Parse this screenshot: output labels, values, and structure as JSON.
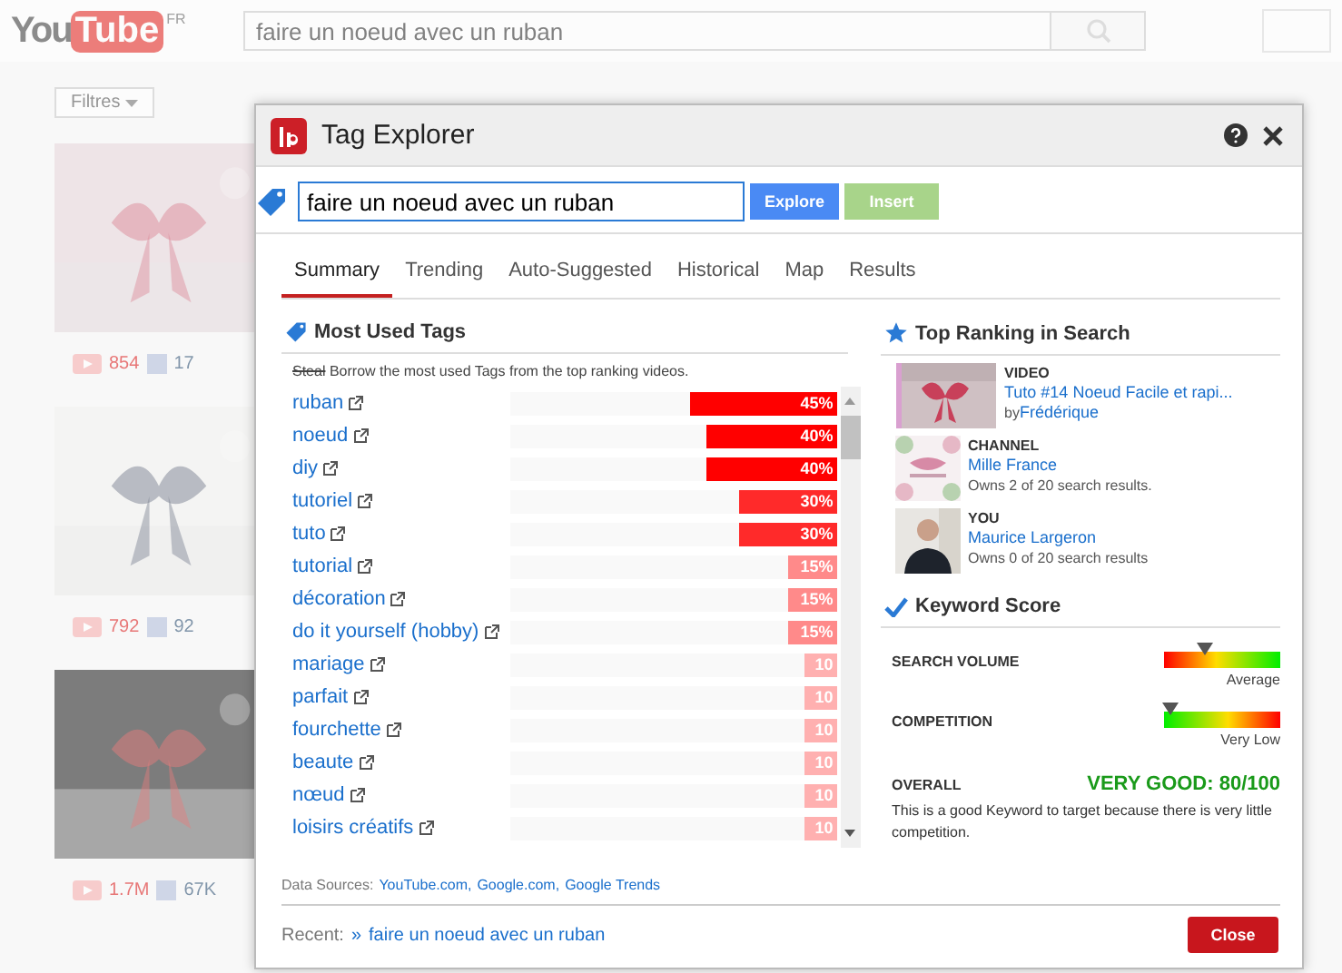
{
  "background": {
    "logo_you": "You",
    "logo_tube": "Tube",
    "logo_region": "FR",
    "search_value": "faire un noeud avec un ruban",
    "filter_button": "Filtres",
    "videos": [
      {
        "views": "854",
        "shares": "17"
      },
      {
        "views": "792",
        "shares": "92"
      },
      {
        "views": "1.7M",
        "shares": "67K"
      }
    ]
  },
  "dialog": {
    "title": "Tag Explorer",
    "search_value": "faire un noeud avec un ruban",
    "explore_button": "Explore",
    "insert_button": "Insert",
    "tabs": [
      {
        "label": "Summary",
        "selected": true
      },
      {
        "label": "Trending",
        "selected": false
      },
      {
        "label": "Auto-Suggested",
        "selected": false
      },
      {
        "label": "Historical",
        "selected": false
      },
      {
        "label": "Map",
        "selected": false
      },
      {
        "label": "Results",
        "selected": false
      }
    ],
    "most_used": {
      "title": "Most Used Tags",
      "struck": "Steal",
      "description": "Borrow the most used Tags from the top ranking videos.",
      "tags": [
        {
          "name": "ruban",
          "value": "45%",
          "level": 0.45,
          "color": "#ff0000"
        },
        {
          "name": "noeud",
          "value": "40%",
          "level": 0.4,
          "color": "#ff0000"
        },
        {
          "name": "diy",
          "value": "40%",
          "level": 0.4,
          "color": "#ff0000"
        },
        {
          "name": "tutoriel",
          "value": "30%",
          "level": 0.3,
          "color": "#ff2a2a"
        },
        {
          "name": "tuto",
          "value": "30%",
          "level": 0.3,
          "color": "#ff2a2a"
        },
        {
          "name": "tutorial",
          "value": "15%",
          "level": 0.15,
          "color": "#ff8a8a"
        },
        {
          "name": "décoration",
          "value": "15%",
          "level": 0.15,
          "color": "#ff8a8a"
        },
        {
          "name": "do it yourself (hobby)",
          "value": "15%",
          "level": 0.15,
          "color": "#ff8a8a"
        },
        {
          "name": "mariage",
          "value": "10",
          "level": 0.1,
          "color": "#ffb0b0"
        },
        {
          "name": "parfait",
          "value": "10",
          "level": 0.1,
          "color": "#ffb0b0"
        },
        {
          "name": "fourchette",
          "value": "10",
          "level": 0.1,
          "color": "#ffb0b0"
        },
        {
          "name": "beaute",
          "value": "10",
          "level": 0.1,
          "color": "#ffb0b0"
        },
        {
          "name": "nœud",
          "value": "10",
          "level": 0.1,
          "color": "#ffb0b0"
        },
        {
          "name": "loisirs créatifs",
          "value": "10",
          "level": 0.1,
          "color": "#ffb0b0"
        }
      ]
    },
    "top_ranking": {
      "title": "Top Ranking in Search",
      "items": [
        {
          "kind": "video",
          "label": "VIDEO",
          "link": "Tuto #14 Noeud Facile et rapi...",
          "by": "by",
          "author": "Frédérique"
        },
        {
          "kind": "channel",
          "label": "CHANNEL",
          "link": "Mille France",
          "note": "Owns 2 of 20 search results."
        },
        {
          "kind": "you",
          "label": "YOU",
          "link": "Maurice Largeron",
          "note": "Owns 0 of 20 search results"
        }
      ]
    },
    "keyword_score": {
      "title": "Keyword Score",
      "meters": [
        {
          "label": "SEARCH VOLUME",
          "kind": "rising",
          "level": 0.35,
          "reading": "Average"
        },
        {
          "label": "COMPETITION",
          "kind": "falling",
          "level": 0.05,
          "reading": "Very Low"
        }
      ],
      "overall_label": "OVERALL",
      "overall_value": "VERY GOOD: 80/100",
      "overall_text": "This is a good Keyword to target because there is very little competition."
    },
    "sources_label": "Data Sources:",
    "sources": [
      "YouTube.com,",
      "Google.com,",
      "Google Trends"
    ],
    "recent_label": "Recent:",
    "recent_marker": "»",
    "recent_link": "faire un noeud avec un ruban",
    "close_button": "Close"
  }
}
